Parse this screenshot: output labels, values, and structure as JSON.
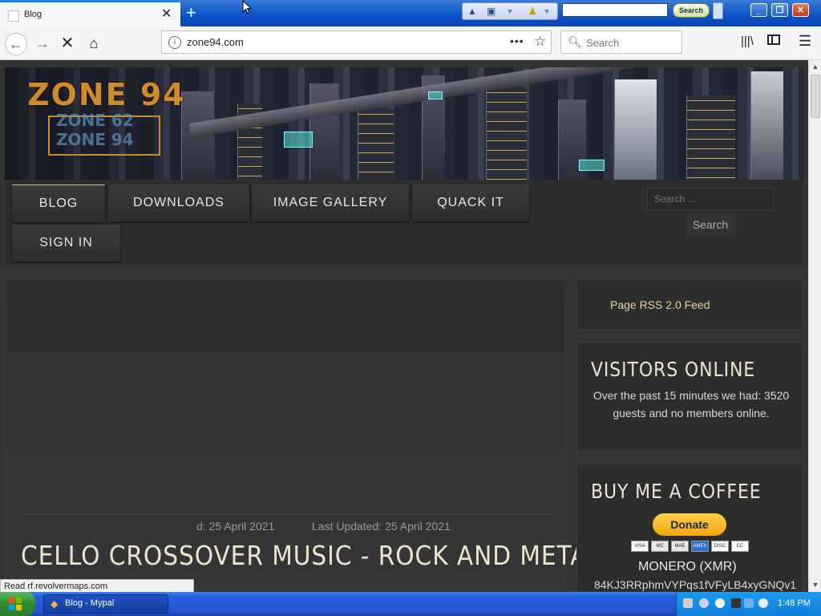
{
  "browser": {
    "tab_title": "Blog",
    "new_tab": "+",
    "close": "✕",
    "url": "zone94.com",
    "url_menu": "•••",
    "search_placeholder": "Search",
    "top_search_button": "Search",
    "status_text": "Read rf.revolvermaps.com"
  },
  "site": {
    "logo": "ZONE 94",
    "logo_sub1": "ZONE 62",
    "logo_sub2": "ZONE 94",
    "menu": [
      "BLOG",
      "DOWNLOADS",
      "IMAGE GALLERY",
      "QUACK IT",
      "SIGN IN"
    ],
    "search_placeholder": "Search ...",
    "search_button": "Search"
  },
  "article": {
    "title": "CELLO CROSSOVER MUSIC - ROCK AND METAL",
    "created": "d: 25 April 2021",
    "updated": "Last Updated: 25 April 2021"
  },
  "sidebar": {
    "rss_link": "Page RSS 2.0 Feed",
    "visitors_title": "VISITORS ONLINE",
    "visitors_text": "Over the past 15 minutes we had: 3520 guests and no members online.",
    "coffee_title": "BUY ME A COFFEE",
    "donate_label": "Donate",
    "cards": [
      "VISA",
      "MC",
      "MAE",
      "AMEX",
      "DISC",
      "CC"
    ],
    "monero_label": "MONERO (XMR)",
    "monero_address": "84KJ3RRphmVYPqs1fVFyLB4xyGNQv1"
  },
  "taskbar": {
    "task_label": "Blog - Mypal",
    "clock": "1:48 PM"
  },
  "colors": {
    "accent_gold": "#e7d49a",
    "title_cream": "#ece4cf",
    "logo_orange": "#d08a2a",
    "xp_blue": "#245edb"
  }
}
